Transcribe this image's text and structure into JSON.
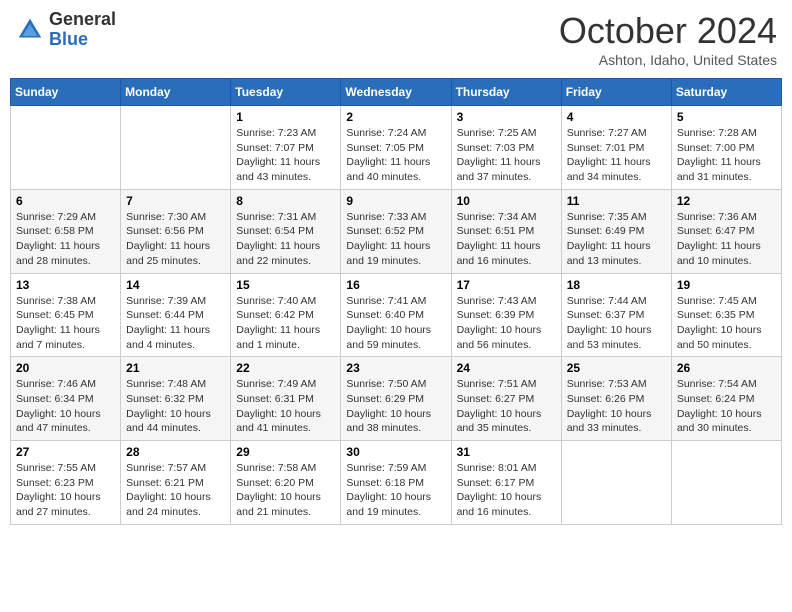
{
  "header": {
    "logo_general": "General",
    "logo_blue": "Blue",
    "title": "October 2024",
    "location": "Ashton, Idaho, United States"
  },
  "days_of_week": [
    "Sunday",
    "Monday",
    "Tuesday",
    "Wednesday",
    "Thursday",
    "Friday",
    "Saturday"
  ],
  "weeks": [
    [
      null,
      null,
      {
        "day": "1",
        "sunrise": "Sunrise: 7:23 AM",
        "sunset": "Sunset: 7:07 PM",
        "daylight": "Daylight: 11 hours and 43 minutes."
      },
      {
        "day": "2",
        "sunrise": "Sunrise: 7:24 AM",
        "sunset": "Sunset: 7:05 PM",
        "daylight": "Daylight: 11 hours and 40 minutes."
      },
      {
        "day": "3",
        "sunrise": "Sunrise: 7:25 AM",
        "sunset": "Sunset: 7:03 PM",
        "daylight": "Daylight: 11 hours and 37 minutes."
      },
      {
        "day": "4",
        "sunrise": "Sunrise: 7:27 AM",
        "sunset": "Sunset: 7:01 PM",
        "daylight": "Daylight: 11 hours and 34 minutes."
      },
      {
        "day": "5",
        "sunrise": "Sunrise: 7:28 AM",
        "sunset": "Sunset: 7:00 PM",
        "daylight": "Daylight: 11 hours and 31 minutes."
      }
    ],
    [
      {
        "day": "6",
        "sunrise": "Sunrise: 7:29 AM",
        "sunset": "Sunset: 6:58 PM",
        "daylight": "Daylight: 11 hours and 28 minutes."
      },
      {
        "day": "7",
        "sunrise": "Sunrise: 7:30 AM",
        "sunset": "Sunset: 6:56 PM",
        "daylight": "Daylight: 11 hours and 25 minutes."
      },
      {
        "day": "8",
        "sunrise": "Sunrise: 7:31 AM",
        "sunset": "Sunset: 6:54 PM",
        "daylight": "Daylight: 11 hours and 22 minutes."
      },
      {
        "day": "9",
        "sunrise": "Sunrise: 7:33 AM",
        "sunset": "Sunset: 6:52 PM",
        "daylight": "Daylight: 11 hours and 19 minutes."
      },
      {
        "day": "10",
        "sunrise": "Sunrise: 7:34 AM",
        "sunset": "Sunset: 6:51 PM",
        "daylight": "Daylight: 11 hours and 16 minutes."
      },
      {
        "day": "11",
        "sunrise": "Sunrise: 7:35 AM",
        "sunset": "Sunset: 6:49 PM",
        "daylight": "Daylight: 11 hours and 13 minutes."
      },
      {
        "day": "12",
        "sunrise": "Sunrise: 7:36 AM",
        "sunset": "Sunset: 6:47 PM",
        "daylight": "Daylight: 11 hours and 10 minutes."
      }
    ],
    [
      {
        "day": "13",
        "sunrise": "Sunrise: 7:38 AM",
        "sunset": "Sunset: 6:45 PM",
        "daylight": "Daylight: 11 hours and 7 minutes."
      },
      {
        "day": "14",
        "sunrise": "Sunrise: 7:39 AM",
        "sunset": "Sunset: 6:44 PM",
        "daylight": "Daylight: 11 hours and 4 minutes."
      },
      {
        "day": "15",
        "sunrise": "Sunrise: 7:40 AM",
        "sunset": "Sunset: 6:42 PM",
        "daylight": "Daylight: 11 hours and 1 minute."
      },
      {
        "day": "16",
        "sunrise": "Sunrise: 7:41 AM",
        "sunset": "Sunset: 6:40 PM",
        "daylight": "Daylight: 10 hours and 59 minutes."
      },
      {
        "day": "17",
        "sunrise": "Sunrise: 7:43 AM",
        "sunset": "Sunset: 6:39 PM",
        "daylight": "Daylight: 10 hours and 56 minutes."
      },
      {
        "day": "18",
        "sunrise": "Sunrise: 7:44 AM",
        "sunset": "Sunset: 6:37 PM",
        "daylight": "Daylight: 10 hours and 53 minutes."
      },
      {
        "day": "19",
        "sunrise": "Sunrise: 7:45 AM",
        "sunset": "Sunset: 6:35 PM",
        "daylight": "Daylight: 10 hours and 50 minutes."
      }
    ],
    [
      {
        "day": "20",
        "sunrise": "Sunrise: 7:46 AM",
        "sunset": "Sunset: 6:34 PM",
        "daylight": "Daylight: 10 hours and 47 minutes."
      },
      {
        "day": "21",
        "sunrise": "Sunrise: 7:48 AM",
        "sunset": "Sunset: 6:32 PM",
        "daylight": "Daylight: 10 hours and 44 minutes."
      },
      {
        "day": "22",
        "sunrise": "Sunrise: 7:49 AM",
        "sunset": "Sunset: 6:31 PM",
        "daylight": "Daylight: 10 hours and 41 minutes."
      },
      {
        "day": "23",
        "sunrise": "Sunrise: 7:50 AM",
        "sunset": "Sunset: 6:29 PM",
        "daylight": "Daylight: 10 hours and 38 minutes."
      },
      {
        "day": "24",
        "sunrise": "Sunrise: 7:51 AM",
        "sunset": "Sunset: 6:27 PM",
        "daylight": "Daylight: 10 hours and 35 minutes."
      },
      {
        "day": "25",
        "sunrise": "Sunrise: 7:53 AM",
        "sunset": "Sunset: 6:26 PM",
        "daylight": "Daylight: 10 hours and 33 minutes."
      },
      {
        "day": "26",
        "sunrise": "Sunrise: 7:54 AM",
        "sunset": "Sunset: 6:24 PM",
        "daylight": "Daylight: 10 hours and 30 minutes."
      }
    ],
    [
      {
        "day": "27",
        "sunrise": "Sunrise: 7:55 AM",
        "sunset": "Sunset: 6:23 PM",
        "daylight": "Daylight: 10 hours and 27 minutes."
      },
      {
        "day": "28",
        "sunrise": "Sunrise: 7:57 AM",
        "sunset": "Sunset: 6:21 PM",
        "daylight": "Daylight: 10 hours and 24 minutes."
      },
      {
        "day": "29",
        "sunrise": "Sunrise: 7:58 AM",
        "sunset": "Sunset: 6:20 PM",
        "daylight": "Daylight: 10 hours and 21 minutes."
      },
      {
        "day": "30",
        "sunrise": "Sunrise: 7:59 AM",
        "sunset": "Sunset: 6:18 PM",
        "daylight": "Daylight: 10 hours and 19 minutes."
      },
      {
        "day": "31",
        "sunrise": "Sunrise: 8:01 AM",
        "sunset": "Sunset: 6:17 PM",
        "daylight": "Daylight: 10 hours and 16 minutes."
      },
      null,
      null
    ]
  ]
}
